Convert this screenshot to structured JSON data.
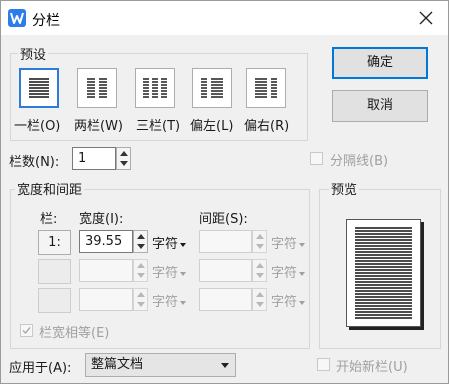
{
  "window": {
    "title": "分栏"
  },
  "presets": {
    "section_label": "预设",
    "items": [
      {
        "label": "一栏(O)",
        "icon": "one-column-icon",
        "selected": true
      },
      {
        "label": "两栏(W)",
        "icon": "two-columns-icon",
        "selected": false
      },
      {
        "label": "三栏(T)",
        "icon": "three-columns-icon",
        "selected": false
      },
      {
        "label": "偏左(L)",
        "icon": "left-columns-icon",
        "selected": false
      },
      {
        "label": "偏右(R)",
        "icon": "right-columns-icon",
        "selected": false
      }
    ]
  },
  "buttons": {
    "ok": "确定",
    "cancel": "取消"
  },
  "column_count": {
    "label": "栏数(N):",
    "value": "1"
  },
  "separator": {
    "label": "分隔线(B)",
    "checked": false,
    "enabled": false
  },
  "width_spacing": {
    "section_label": "宽度和间距",
    "col_header": "栏:",
    "width_header": "宽度(I):",
    "spacing_header": "间距(S):",
    "rows": [
      {
        "num": "1:",
        "width": "39.55",
        "width_unit": "字符",
        "spacing": "",
        "spacing_unit": "字符",
        "enabled": true
      },
      {
        "num": "",
        "width": "",
        "width_unit": "字符",
        "spacing": "",
        "spacing_unit": "字符",
        "enabled": false
      },
      {
        "num": "",
        "width": "",
        "width_unit": "字符",
        "spacing": "",
        "spacing_unit": "字符",
        "enabled": false
      }
    ],
    "equal_width": {
      "label": "栏宽相等(E)",
      "checked": true,
      "enabled": false
    }
  },
  "preview": {
    "label": "预览"
  },
  "apply_to": {
    "label": "应用于(A):",
    "value": "整篇文档"
  },
  "new_column": {
    "label": "开始新栏(U)",
    "checked": false,
    "enabled": false
  },
  "colors": {
    "accent": "#2f7bd8",
    "title_bar": "#ffffff",
    "dialog_bg": "#f0f0f0"
  }
}
